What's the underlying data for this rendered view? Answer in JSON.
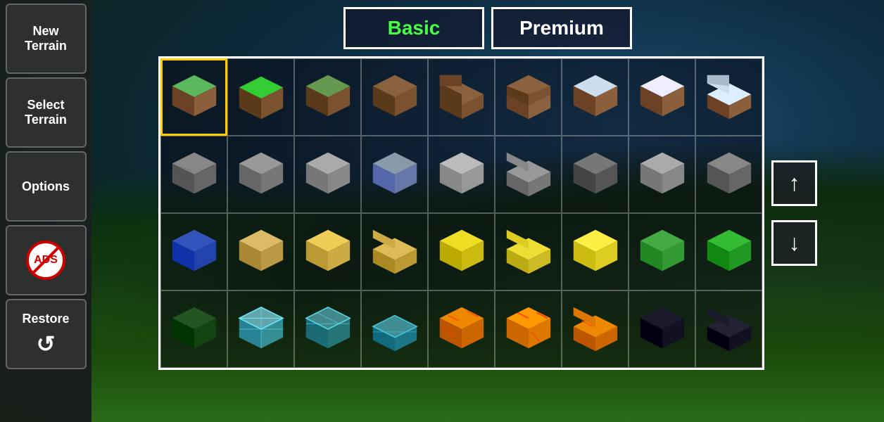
{
  "sidebar": {
    "buttons": [
      {
        "id": "new-terrain",
        "line1": "New",
        "line2": "Terrain",
        "icon": null
      },
      {
        "id": "select-terrain",
        "line1": "Select",
        "line2": "Terrain",
        "icon": null
      },
      {
        "id": "options",
        "line1": "Options",
        "line2": "",
        "icon": null
      },
      {
        "id": "ads",
        "line1": "",
        "line2": "",
        "icon": "ads"
      },
      {
        "id": "restore",
        "line1": "Restore",
        "line2": "",
        "icon": "restore"
      }
    ]
  },
  "tabs": [
    {
      "id": "basic",
      "label": "Basic",
      "active": true
    },
    {
      "id": "premium",
      "label": "Premium",
      "active": false
    }
  ],
  "scroll": {
    "up": "↑",
    "down": "↓"
  },
  "grid": {
    "rows": 4,
    "cols": 9,
    "selected_index": 0
  },
  "colors": {
    "active_tab": "#44ff44",
    "border": "#ffffff",
    "selected_border": "#ffcc00",
    "bg_dark": "#1a3a1a"
  },
  "blocks": [
    {
      "row": 0,
      "col": 0,
      "type": "grass-full",
      "top": "#5cb85c",
      "side": "#8B5E3C",
      "front": "#6b4226",
      "selected": true
    },
    {
      "row": 0,
      "col": 1,
      "type": "grass-flat",
      "top": "#33cc33",
      "side": "#8B5E3C",
      "front": "#6b4226",
      "selected": false
    },
    {
      "row": 0,
      "col": 2,
      "type": "dirt-grass",
      "top": "#7a5230",
      "side": "#8B5E3C",
      "front": "#6b4226",
      "selected": false
    },
    {
      "row": 0,
      "col": 3,
      "type": "dirt",
      "top": "#7a5230",
      "side": "#7a5230",
      "front": "#6b4226",
      "selected": false
    },
    {
      "row": 0,
      "col": 4,
      "type": "dirt-step",
      "top": "#8a6240",
      "side": "#7a5230",
      "front": "#6b4226",
      "selected": false
    },
    {
      "row": 0,
      "col": 5,
      "type": "dirt-step2",
      "top": "#8a6240",
      "side": "#9a7250",
      "front": "#7a5230",
      "selected": false
    },
    {
      "row": 0,
      "col": 6,
      "type": "snow-full",
      "top": "#ccddee",
      "side": "#8B5E3C",
      "front": "#6b4226",
      "selected": false
    },
    {
      "row": 0,
      "col": 7,
      "type": "snow-flat",
      "top": "#eeeeff",
      "side": "#8B5E3C",
      "front": "#6b4226",
      "selected": false
    },
    {
      "row": 0,
      "col": 8,
      "type": "snow-step",
      "top": "#ddeeff",
      "side": "#8B5E3C",
      "front": "#7a5230",
      "selected": false
    },
    {
      "row": 1,
      "col": 0,
      "type": "stone1",
      "top": "#888",
      "side": "#777",
      "front": "#666",
      "selected": false
    },
    {
      "row": 1,
      "col": 1,
      "type": "stone2",
      "top": "#999",
      "side": "#888",
      "front": "#777",
      "selected": false
    },
    {
      "row": 1,
      "col": 2,
      "type": "stone3",
      "top": "#aaa",
      "side": "#999",
      "front": "#888",
      "selected": false
    },
    {
      "row": 1,
      "col": 3,
      "type": "stone-blue",
      "top": "#8899aa",
      "side": "#7788aa",
      "front": "#6677aa",
      "selected": false
    },
    {
      "row": 1,
      "col": 4,
      "type": "stone-light",
      "top": "#bbbbbb",
      "side": "#aaaaaa",
      "front": "#999999",
      "selected": false
    },
    {
      "row": 1,
      "col": 5,
      "type": "stone-step",
      "top": "#999",
      "side": "#888",
      "front": "#777",
      "selected": false
    },
    {
      "row": 1,
      "col": 6,
      "type": "stone-dark",
      "top": "#777",
      "side": "#666",
      "front": "#555",
      "selected": false
    },
    {
      "row": 1,
      "col": 7,
      "type": "stone-grey",
      "top": "#aaa",
      "side": "#999",
      "front": "#888",
      "selected": false
    },
    {
      "row": 1,
      "col": 8,
      "type": "stone-dkgrey",
      "top": "#888",
      "side": "#777",
      "front": "#666",
      "selected": false
    },
    {
      "row": 2,
      "col": 0,
      "type": "blue-block",
      "top": "#3355bb",
      "side": "#2244aa",
      "front": "#1133aa",
      "selected": false
    },
    {
      "row": 2,
      "col": 1,
      "type": "wood-plank",
      "top": "#ddbb66",
      "side": "#bb9944",
      "front": "#aa8833",
      "selected": false
    },
    {
      "row": 2,
      "col": 2,
      "type": "wood-flat",
      "top": "#eecc55",
      "side": "#ccaa44",
      "front": "#bb9933",
      "selected": false
    },
    {
      "row": 2,
      "col": 3,
      "type": "wood-step",
      "top": "#ddbb55",
      "side": "#bb9933",
      "front": "#aa8822",
      "selected": false
    },
    {
      "row": 2,
      "col": 4,
      "type": "yellow-bright",
      "top": "#eedd22",
      "side": "#ccbb11",
      "front": "#bbaa00",
      "selected": false
    },
    {
      "row": 2,
      "col": 5,
      "type": "yellow-step",
      "top": "#eedd33",
      "side": "#ccbb22",
      "front": "#bbaa11",
      "selected": false
    },
    {
      "row": 2,
      "col": 6,
      "type": "yellow-flat",
      "top": "#ffee44",
      "side": "#ddcc22",
      "front": "#ccbb11",
      "selected": false
    },
    {
      "row": 2,
      "col": 7,
      "type": "green-mossy",
      "top": "#44aa44",
      "side": "#33993",
      "front": "#228822",
      "selected": false
    },
    {
      "row": 2,
      "col": 8,
      "type": "green-block",
      "top": "#33bb33",
      "side": "#229922",
      "front": "#118811",
      "selected": false
    },
    {
      "row": 3,
      "col": 0,
      "type": "green-dark",
      "top": "#225522",
      "side": "#114411",
      "front": "#003300",
      "selected": false
    },
    {
      "row": 3,
      "col": 1,
      "type": "diamond-block",
      "top": "#88ddee",
      "side": "#44bbcc",
      "front": "#33aacc",
      "selected": false
    },
    {
      "row": 3,
      "col": 2,
      "type": "diamond-flat",
      "top": "#66ccdd",
      "side": "#33aabb",
      "front": "#2299bb",
      "selected": false
    },
    {
      "row": 3,
      "col": 3,
      "type": "diamond-step",
      "top": "#55bbcc",
      "side": "#2299bb",
      "front": "#1188aa",
      "selected": false
    },
    {
      "row": 3,
      "col": 4,
      "type": "lava1",
      "top": "#ee8800",
      "side": "#cc6600",
      "front": "#bb5500",
      "selected": false
    },
    {
      "row": 3,
      "col": 5,
      "type": "lava2",
      "top": "#ff9900",
      "side": "#dd7700",
      "front": "#cc6600",
      "selected": false
    },
    {
      "row": 3,
      "col": 6,
      "type": "lava-step",
      "top": "#ee8800",
      "side": "#cc6600",
      "front": "#bb5500",
      "selected": false
    },
    {
      "row": 3,
      "col": 7,
      "type": "obsidian",
      "top": "#1a1a2a",
      "side": "#111122",
      "front": "#000011",
      "selected": false
    },
    {
      "row": 3,
      "col": 8,
      "type": "obsidian-step",
      "top": "#222233",
      "side": "#111122",
      "front": "#000011",
      "selected": false
    }
  ]
}
